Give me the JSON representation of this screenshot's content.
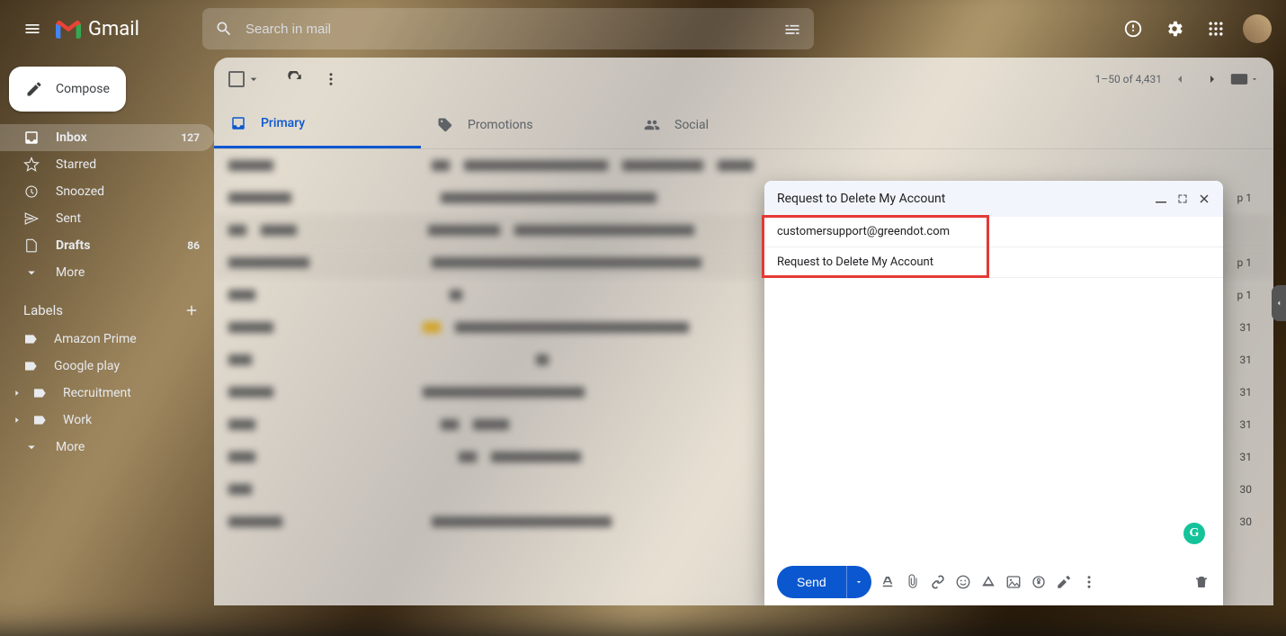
{
  "header": {
    "product": "Gmail",
    "search_placeholder": "Search in mail"
  },
  "compose_label": "Compose",
  "nav": {
    "inbox": {
      "label": "Inbox",
      "count": "127"
    },
    "starred": {
      "label": "Starred"
    },
    "snoozed": {
      "label": "Snoozed"
    },
    "sent": {
      "label": "Sent"
    },
    "drafts": {
      "label": "Drafts",
      "count": "86"
    },
    "more": {
      "label": "More"
    }
  },
  "labels": {
    "heading": "Labels",
    "items": [
      "Amazon Prime",
      "Google play",
      "Recruitment",
      "Work",
      "More"
    ]
  },
  "toolbar": {
    "range": "1–50 of 4,431"
  },
  "tabs": {
    "primary": "Primary",
    "promotions": "Promotions",
    "social": "Social"
  },
  "row_dates": [
    "",
    "p 1",
    "",
    "p 1",
    "p 1",
    "31",
    "31",
    "31",
    "31",
    "31",
    "30",
    "30"
  ],
  "compose_window": {
    "title": "Request to Delete My Account",
    "to": "customersupport@greendot.com",
    "subject": "Request to Delete My Account",
    "send": "Send"
  },
  "grammarly_glyph": "G"
}
